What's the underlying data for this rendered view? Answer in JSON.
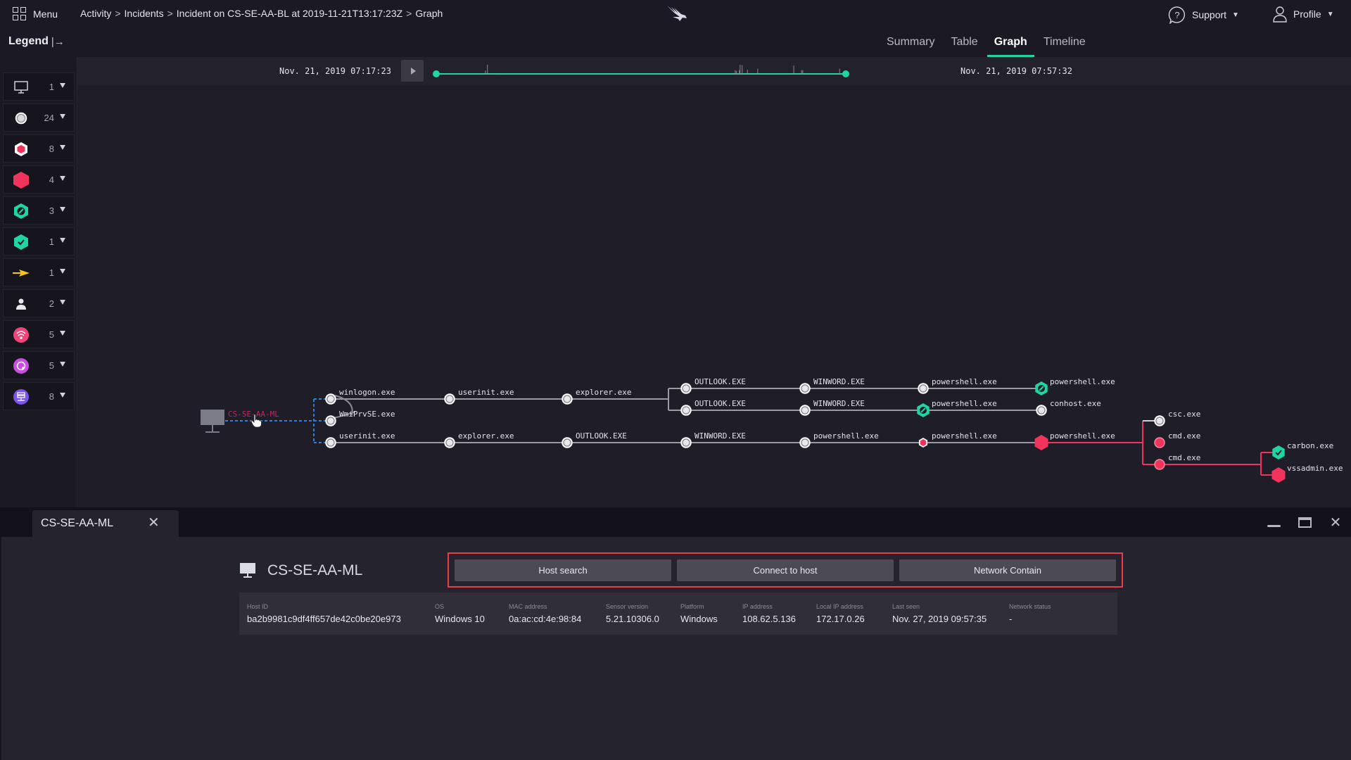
{
  "topbar": {
    "menu_label": "Menu",
    "breadcrumb": [
      "Activity",
      "Incidents",
      "Incident on CS-SE-AA-BL at 2019-11-21T13:17:23Z",
      "Graph"
    ],
    "breadcrumb_sep": ">",
    "logo_icon": "falcon-logo-icon",
    "support_label": "Support",
    "profile_label": "Profile"
  },
  "subbar": {
    "legend_label": "Legend",
    "legend_toggle_icon": "|→",
    "tabs": [
      {
        "label": "Summary",
        "active": false
      },
      {
        "label": "Table",
        "active": false
      },
      {
        "label": "Graph",
        "active": true
      },
      {
        "label": "Timeline",
        "active": false
      }
    ]
  },
  "timeline": {
    "start": "Nov. 21, 2019 07:17:23",
    "end": "Nov. 21, 2019 07:57:32",
    "accent": "#1fd6a1",
    "event_positions": [
      0.12,
      0.125,
      0.73,
      0.733,
      0.74,
      0.742,
      0.747,
      0.76,
      0.785,
      0.873,
      0.892,
      0.895,
      0.985
    ],
    "event_heights": [
      0.25,
      1.0,
      0.3,
      0.2,
      0.3,
      1.0,
      0.95,
      0.35,
      0.5,
      0.9,
      0.3,
      0.3,
      0.5
    ]
  },
  "legend": {
    "items": [
      {
        "icon": "host-icon",
        "count": "1"
      },
      {
        "icon": "process-icon",
        "count": "24"
      },
      {
        "icon": "detection-outlined-hex-icon",
        "count": "8"
      },
      {
        "icon": "detection-hex-icon",
        "count": "4"
      },
      {
        "icon": "blocked-hex-icon",
        "count": "3"
      },
      {
        "icon": "allowed-hex-icon",
        "count": "1"
      },
      {
        "icon": "lateral-arrow-icon",
        "count": "1"
      },
      {
        "icon": "user-icon",
        "count": "2"
      },
      {
        "icon": "network-icon",
        "count": "5"
      },
      {
        "icon": "disk-icon",
        "count": "5"
      },
      {
        "icon": "dns-server-icon",
        "count": "8"
      }
    ]
  },
  "graph": {
    "host_label": "CS-SE-AA-ML",
    "colors": {
      "normal": "#e8e8ec",
      "detect": "#f2345c",
      "blocked": "#1fd6a1",
      "host_link": "#2f7fd6",
      "edge": "#9a9aa4"
    },
    "nodes": [
      {
        "id": "n1",
        "label": "winlogon.exe",
        "type": "process"
      },
      {
        "id": "n2",
        "label": "WmiPrvSE.exe",
        "type": "process"
      },
      {
        "id": "n3",
        "label": "userinit.exe",
        "type": "process"
      },
      {
        "id": "n4",
        "label": "userinit.exe",
        "type": "process"
      },
      {
        "id": "n5",
        "label": "explorer.exe",
        "type": "process"
      },
      {
        "id": "n6",
        "label": "OUTLOOK.EXE",
        "type": "process"
      },
      {
        "id": "n7",
        "label": "OUTLOOK.EXE",
        "type": "process"
      },
      {
        "id": "n8",
        "label": "WINWORD.EXE",
        "type": "process"
      },
      {
        "id": "n9",
        "label": "WINWORD.EXE",
        "type": "process"
      },
      {
        "id": "n10",
        "label": "powershell.exe",
        "type": "process"
      },
      {
        "id": "n11",
        "label": "powershell.exe",
        "type": "blocked"
      },
      {
        "id": "n12",
        "label": "powershell.exe",
        "type": "blocked"
      },
      {
        "id": "n13",
        "label": "conhost.exe",
        "type": "process"
      },
      {
        "id": "n14",
        "label": "explorer.exe",
        "type": "process"
      },
      {
        "id": "n15",
        "label": "OUTLOOK.EXE",
        "type": "process"
      },
      {
        "id": "n16",
        "label": "WINWORD.EXE",
        "type": "process"
      },
      {
        "id": "n17",
        "label": "powershell.exe",
        "type": "process"
      },
      {
        "id": "n18",
        "label": "powershell.exe",
        "type": "detect-outlined"
      },
      {
        "id": "n19",
        "label": "powershell.exe",
        "type": "detect"
      },
      {
        "id": "n20",
        "label": "csc.exe",
        "type": "process"
      },
      {
        "id": "n21",
        "label": "cmd.exe",
        "type": "process-detect"
      },
      {
        "id": "n22",
        "label": "cmd.exe",
        "type": "process-detect"
      },
      {
        "id": "n23",
        "label": "carbon.exe",
        "type": "allowed"
      },
      {
        "id": "n24",
        "label": "vssadmin.exe",
        "type": "detect"
      }
    ]
  },
  "bottom": {
    "tab_label": "CS-SE-AA-ML",
    "host_name": "CS-SE-AA-ML",
    "actions": [
      "Host search",
      "Connect to host",
      "Network Contain"
    ],
    "fields": [
      {
        "key": "Host ID",
        "value": "ba2b9981c9df4ff657de42c0be20e973"
      },
      {
        "key": "OS",
        "value": "Windows 10"
      },
      {
        "key": "MAC address",
        "value": "0a:ac:cd:4e:98:84"
      },
      {
        "key": "Sensor version",
        "value": "5.21.10306.0"
      },
      {
        "key": "Platform",
        "value": "Windows"
      },
      {
        "key": "IP address",
        "value": "108.62.5.136"
      },
      {
        "key": "Local IP address",
        "value": "172.17.0.26"
      },
      {
        "key": "Last seen",
        "value": "Nov. 27, 2019 09:57:35"
      },
      {
        "key": "Network status",
        "value": "-"
      }
    ]
  }
}
